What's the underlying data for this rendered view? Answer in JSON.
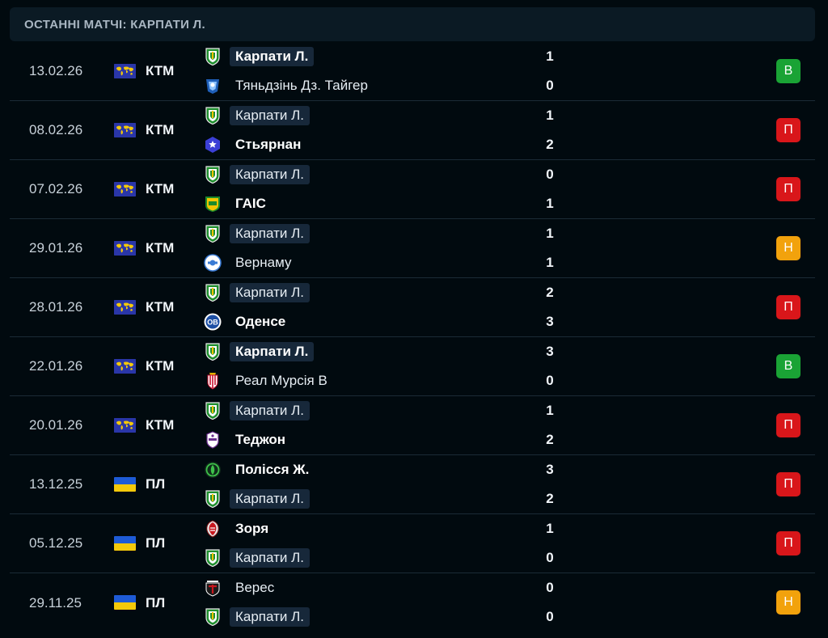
{
  "header": {
    "title": "ОСТАННІ МАТЧІ: КАРПАТИ Л."
  },
  "matches": [
    {
      "date": "13.02.26",
      "flag": "world-flag-icon",
      "competition": "КТМ",
      "home": {
        "name": "Карпати Л.",
        "crest": "karpaty-crest-icon",
        "winner": true,
        "highlight": true
      },
      "away": {
        "name": "Тяньдзінь Дз. Тайгер",
        "crest": "tianjin-crest-icon",
        "winner": false,
        "highlight": false
      },
      "home_score": "1",
      "away_score": "0",
      "result": "В",
      "result_type": "win"
    },
    {
      "date": "08.02.26",
      "flag": "world-flag-icon",
      "competition": "КТМ",
      "home": {
        "name": "Карпати Л.",
        "crest": "karpaty-crest-icon",
        "winner": false,
        "highlight": true
      },
      "away": {
        "name": "Стьярнан",
        "crest": "stjarnan-crest-icon",
        "winner": true,
        "highlight": false
      },
      "home_score": "1",
      "away_score": "2",
      "result": "П",
      "result_type": "loss"
    },
    {
      "date": "07.02.26",
      "flag": "world-flag-icon",
      "competition": "КТМ",
      "home": {
        "name": "Карпати Л.",
        "crest": "karpaty-crest-icon",
        "winner": false,
        "highlight": true
      },
      "away": {
        "name": "ГАІС",
        "crest": "gais-crest-icon",
        "winner": true,
        "highlight": false
      },
      "home_score": "0",
      "away_score": "1",
      "result": "П",
      "result_type": "loss"
    },
    {
      "date": "29.01.26",
      "flag": "world-flag-icon",
      "competition": "КТМ",
      "home": {
        "name": "Карпати Л.",
        "crest": "karpaty-crest-icon",
        "winner": false,
        "highlight": true
      },
      "away": {
        "name": "Вернаму",
        "crest": "varnamo-crest-icon",
        "winner": false,
        "highlight": false
      },
      "home_score": "1",
      "away_score": "1",
      "result": "Н",
      "result_type": "draw"
    },
    {
      "date": "28.01.26",
      "flag": "world-flag-icon",
      "competition": "КТМ",
      "home": {
        "name": "Карпати Л.",
        "crest": "karpaty-crest-icon",
        "winner": false,
        "highlight": true
      },
      "away": {
        "name": "Оденсе",
        "crest": "odense-crest-icon",
        "winner": true,
        "highlight": false
      },
      "home_score": "2",
      "away_score": "3",
      "result": "П",
      "result_type": "loss"
    },
    {
      "date": "22.01.26",
      "flag": "world-flag-icon",
      "competition": "КТМ",
      "home": {
        "name": "Карпати Л.",
        "crest": "karpaty-crest-icon",
        "winner": true,
        "highlight": true
      },
      "away": {
        "name": "Реал Мурсія B",
        "crest": "real-murcia-crest-icon",
        "winner": false,
        "highlight": false
      },
      "home_score": "3",
      "away_score": "0",
      "result": "В",
      "result_type": "win"
    },
    {
      "date": "20.01.26",
      "flag": "world-flag-icon",
      "competition": "КТМ",
      "home": {
        "name": "Карпати Л.",
        "crest": "karpaty-crest-icon",
        "winner": false,
        "highlight": true
      },
      "away": {
        "name": "Теджон",
        "crest": "daejeon-crest-icon",
        "winner": true,
        "highlight": false
      },
      "home_score": "1",
      "away_score": "2",
      "result": "П",
      "result_type": "loss"
    },
    {
      "date": "13.12.25",
      "flag": "ukraine-flag-icon",
      "competition": "ПЛ",
      "home": {
        "name": "Полісся Ж.",
        "crest": "polissya-crest-icon",
        "winner": true,
        "highlight": false
      },
      "away": {
        "name": "Карпати Л.",
        "crest": "karpaty-crest-icon",
        "winner": false,
        "highlight": true
      },
      "home_score": "3",
      "away_score": "2",
      "result": "П",
      "result_type": "loss"
    },
    {
      "date": "05.12.25",
      "flag": "ukraine-flag-icon",
      "competition": "ПЛ",
      "home": {
        "name": "Зоря",
        "crest": "zorya-crest-icon",
        "winner": true,
        "highlight": false
      },
      "away": {
        "name": "Карпати Л.",
        "crest": "karpaty-crest-icon",
        "winner": false,
        "highlight": true
      },
      "home_score": "1",
      "away_score": "0",
      "result": "П",
      "result_type": "loss"
    },
    {
      "date": "29.11.25",
      "flag": "ukraine-flag-icon",
      "competition": "ПЛ",
      "home": {
        "name": "Верес",
        "crest": "veres-crest-icon",
        "winner": false,
        "highlight": false
      },
      "away": {
        "name": "Карпати Л.",
        "crest": "karpaty-crest-icon",
        "winner": false,
        "highlight": true
      },
      "home_score": "0",
      "away_score": "0",
      "result": "Н",
      "result_type": "draw"
    }
  ],
  "colors": {
    "background": "#010a0f",
    "header_bg": "#0b1a24",
    "win": "#1aa335",
    "loss": "#d9161a",
    "draw": "#f2a20c",
    "highlight": "#17283a"
  }
}
